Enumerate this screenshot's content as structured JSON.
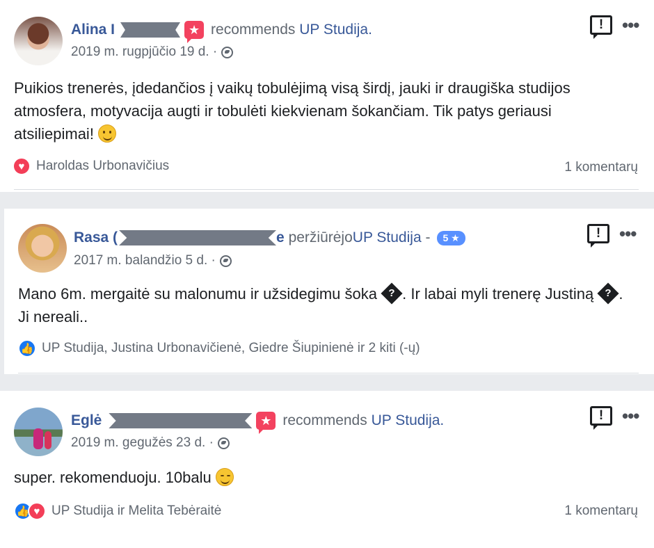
{
  "posts": [
    {
      "author": "Alina I",
      "action_text": "recommends",
      "page_name": "UP Studija.",
      "date": "2019 m. rugpjūčio 19 d. ·",
      "body": "Puikios trenerės, įdedančios į vaikų tobulėjimą visą širdį, jauki ir draugiška studijos atmosfera, motyvacija augti ir tobulėti kiekvienam šokančiam. Tik patys geriausi atsiliepimai!",
      "reactions_label": "Haroldas Urbonavičius",
      "comments": "1 komentarų"
    },
    {
      "author": "Rasa (",
      "name_tail": "e",
      "action_text": "peržiūrėjo",
      "page_name": "UP Studija",
      "separator": "-",
      "rating": "5 ★",
      "date": "2017 m. balandžio 5 d. ·",
      "body_part1": "Mano 6m. mergaitė su malonumu ir užsidegimu šoka",
      "body_part2": ". Ir labai myli trenerę Justiną",
      "body_part3": ". Ji nereali..",
      "unknown_glyph": "?",
      "reactions_label": "UP Studija, Justina Urbonavičienė, Giedre Šiupinienė ir 2 kiti (-ų)"
    },
    {
      "author": "Eglė",
      "action_text": "recommends",
      "page_name": "UP Studija.",
      "date": "2019 m. gegužės 23 d. ·",
      "body": "super. rekomenduoju. 10balu",
      "reactions_label": "UP Studija ir Melita Tebėraitė",
      "comments": "1 komentarų"
    }
  ],
  "icons": {
    "report": "!",
    "more": "•••",
    "recommend": "★",
    "heart": "♥",
    "like": "👍"
  },
  "colors": {
    "link": "#385898",
    "recommend_badge": "#f3425f",
    "rating_badge": "#5890ff",
    "like": "#1877f2",
    "heart": "#f33e58"
  }
}
